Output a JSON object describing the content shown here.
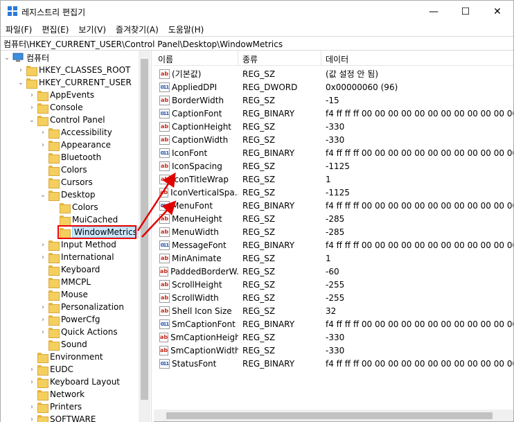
{
  "window": {
    "title": "레지스트리 편집기",
    "minimize": "—",
    "maximize": "☐",
    "close": "✕"
  },
  "menu": [
    "파일(F)",
    "편집(E)",
    "보기(V)",
    "즐겨찾기(A)",
    "도움말(H)"
  ],
  "address": "컴퓨터\\HKEY_CURRENT_USER\\Control Panel\\Desktop\\WindowMetrics",
  "tree": [
    {
      "label": "컴퓨터",
      "level": 0,
      "chev": "⌄",
      "icon": "computer"
    },
    {
      "label": "HKEY_CLASSES_ROOT",
      "level": 1,
      "chev": "›"
    },
    {
      "label": "HKEY_CURRENT_USER",
      "level": 1,
      "chev": "⌄"
    },
    {
      "label": "AppEvents",
      "level": 2,
      "chev": "›"
    },
    {
      "label": "Console",
      "level": 2,
      "chev": "›"
    },
    {
      "label": "Control Panel",
      "level": 2,
      "chev": "⌄"
    },
    {
      "label": "Accessibility",
      "level": 3,
      "chev": "›"
    },
    {
      "label": "Appearance",
      "level": 3,
      "chev": "›"
    },
    {
      "label": "Bluetooth",
      "level": 3,
      "chev": ""
    },
    {
      "label": "Colors",
      "level": 3,
      "chev": ""
    },
    {
      "label": "Cursors",
      "level": 3,
      "chev": ""
    },
    {
      "label": "Desktop",
      "level": 3,
      "chev": "⌄"
    },
    {
      "label": "Colors",
      "level": 4,
      "chev": ""
    },
    {
      "label": "MuiCached",
      "level": 4,
      "chev": ""
    },
    {
      "label": "WindowMetrics",
      "level": 4,
      "chev": "",
      "selected": true
    },
    {
      "label": "Input Method",
      "level": 3,
      "chev": "›"
    },
    {
      "label": "International",
      "level": 3,
      "chev": "›"
    },
    {
      "label": "Keyboard",
      "level": 3,
      "chev": ""
    },
    {
      "label": "MMCPL",
      "level": 3,
      "chev": ""
    },
    {
      "label": "Mouse",
      "level": 3,
      "chev": ""
    },
    {
      "label": "Personalization",
      "level": 3,
      "chev": "›"
    },
    {
      "label": "PowerCfg",
      "level": 3,
      "chev": "›"
    },
    {
      "label": "Quick Actions",
      "level": 3,
      "chev": "›"
    },
    {
      "label": "Sound",
      "level": 3,
      "chev": ""
    },
    {
      "label": "Environment",
      "level": 2,
      "chev": ""
    },
    {
      "label": "EUDC",
      "level": 2,
      "chev": "›"
    },
    {
      "label": "Keyboard Layout",
      "level": 2,
      "chev": "›"
    },
    {
      "label": "Network",
      "level": 2,
      "chev": ""
    },
    {
      "label": "Printers",
      "level": 2,
      "chev": "›"
    },
    {
      "label": "SOFTWARE",
      "level": 2,
      "chev": "›"
    }
  ],
  "columns": {
    "name": "이름",
    "type": "종류",
    "data": "데이터"
  },
  "values": [
    {
      "name": "(기본값)",
      "type": "REG_SZ",
      "data": "(값 설정 안 됨)",
      "icon": "ab"
    },
    {
      "name": "AppliedDPI",
      "type": "REG_DWORD",
      "data": "0x00000060 (96)",
      "icon": "bin"
    },
    {
      "name": "BorderWidth",
      "type": "REG_SZ",
      "data": "-15",
      "icon": "ab"
    },
    {
      "name": "CaptionFont",
      "type": "REG_BINARY",
      "data": "f4 ff ff ff 00 00 00 00 00 00 00 00 00 00 00 00",
      "icon": "bin"
    },
    {
      "name": "CaptionHeight",
      "type": "REG_SZ",
      "data": "-330",
      "icon": "ab"
    },
    {
      "name": "CaptionWidth",
      "type": "REG_SZ",
      "data": "-330",
      "icon": "ab"
    },
    {
      "name": "IconFont",
      "type": "REG_BINARY",
      "data": "f4 ff ff ff 00 00 00 00 00 00 00 00 00 00 00 00",
      "icon": "bin"
    },
    {
      "name": "IconSpacing",
      "type": "REG_SZ",
      "data": "-1125",
      "icon": "ab"
    },
    {
      "name": "IconTitleWrap",
      "type": "REG_SZ",
      "data": "1",
      "icon": "ab"
    },
    {
      "name": "IconVerticalSpa...",
      "type": "REG_SZ",
      "data": "-1125",
      "icon": "ab"
    },
    {
      "name": "MenuFont",
      "type": "REG_BINARY",
      "data": "f4 ff ff ff 00 00 00 00 00 00 00 00 00 00 00 00",
      "icon": "bin"
    },
    {
      "name": "MenuHeight",
      "type": "REG_SZ",
      "data": "-285",
      "icon": "ab"
    },
    {
      "name": "MenuWidth",
      "type": "REG_SZ",
      "data": "-285",
      "icon": "ab"
    },
    {
      "name": "MessageFont",
      "type": "REG_BINARY",
      "data": "f4 ff ff ff 00 00 00 00 00 00 00 00 00 00 00 00",
      "icon": "bin"
    },
    {
      "name": "MinAnimate",
      "type": "REG_SZ",
      "data": "1",
      "icon": "ab"
    },
    {
      "name": "PaddedBorderW...",
      "type": "REG_SZ",
      "data": "-60",
      "icon": "ab"
    },
    {
      "name": "ScrollHeight",
      "type": "REG_SZ",
      "data": "-255",
      "icon": "ab"
    },
    {
      "name": "ScrollWidth",
      "type": "REG_SZ",
      "data": "-255",
      "icon": "ab"
    },
    {
      "name": "Shell Icon Size",
      "type": "REG_SZ",
      "data": "32",
      "icon": "ab"
    },
    {
      "name": "SmCaptionFont",
      "type": "REG_BINARY",
      "data": "f4 ff ff ff 00 00 00 00 00 00 00 00 00 00 00 00",
      "icon": "bin"
    },
    {
      "name": "SmCaptionHeight",
      "type": "REG_SZ",
      "data": "-330",
      "icon": "ab"
    },
    {
      "name": "SmCaptionWidth",
      "type": "REG_SZ",
      "data": "-330",
      "icon": "ab"
    },
    {
      "name": "StatusFont",
      "type": "REG_BINARY",
      "data": "f4 ff ff ff 00 00 00 00 00 00 00 00 00 00 00 00",
      "icon": "bin"
    }
  ],
  "icons": {
    "ab": "ab",
    "bin": "011"
  },
  "colors": {
    "highlight_box": "#e00000",
    "arrow": "#e00000",
    "selection": "#cce8ff"
  }
}
